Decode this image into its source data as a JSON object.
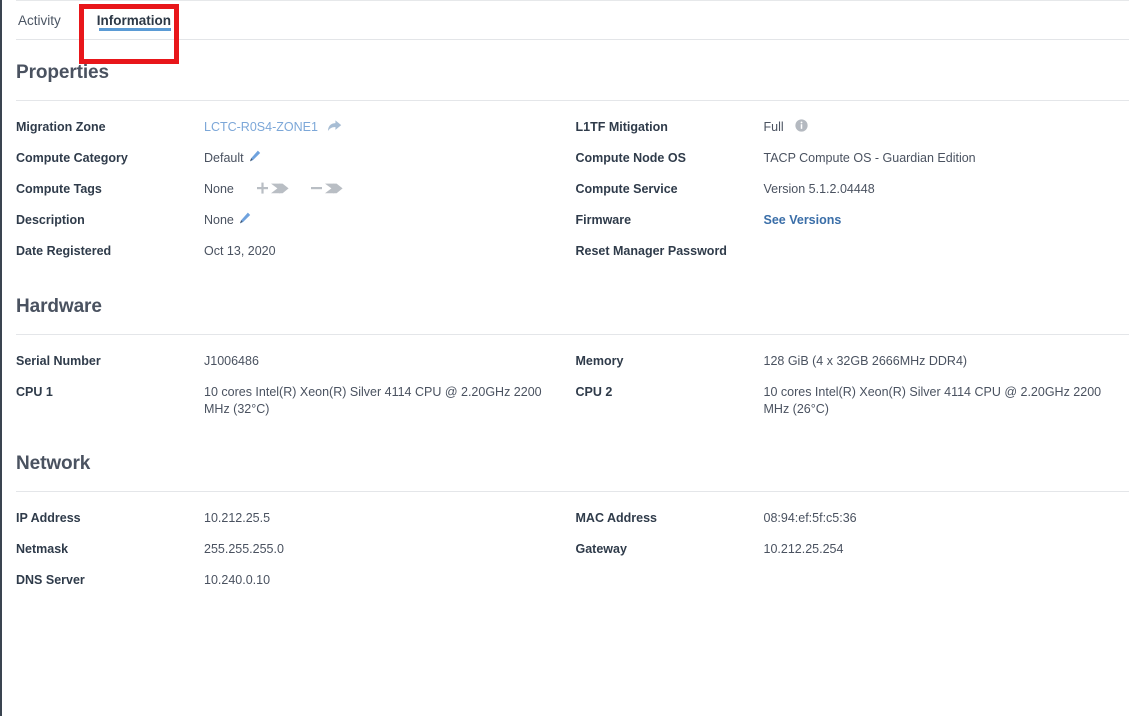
{
  "tabs": [
    {
      "label": "Activity",
      "active": false
    },
    {
      "label": "Information",
      "active": true
    }
  ],
  "annotation": {
    "target": "Information",
    "color": "#e8161a"
  },
  "colors": {
    "accent_tab_underline": "#5b9bd5",
    "link": "#7ca7d8",
    "link_strong": "#3a6ea8",
    "heading": "#4a5260",
    "label": "#2f3b4a",
    "value": "#4a5260",
    "annotation": "#e8161a"
  },
  "sections": [
    {
      "title": "Properties",
      "left": [
        {
          "label": "Migration Zone",
          "value": "LCTC-R0S4-ZONE1",
          "style": "link",
          "icons": [
            "share-icon"
          ]
        },
        {
          "label": "Compute Category",
          "value": "Default",
          "style": "plain",
          "icons": [
            "pencil-icon"
          ]
        },
        {
          "label": "Compute Tags",
          "value": "None",
          "style": "plain",
          "icons": [
            "add-tag-icon",
            "remove-tag-icon"
          ]
        },
        {
          "label": "Description",
          "value": "None",
          "style": "plain",
          "icons": [
            "pencil-icon"
          ]
        },
        {
          "label": "Date Registered",
          "value": "Oct 13, 2020",
          "style": "plain",
          "icons": []
        }
      ],
      "right": [
        {
          "label": "L1TF Mitigation",
          "value": "Full",
          "style": "plain",
          "icons": [
            "info-icon"
          ]
        },
        {
          "label": "Compute Node OS",
          "value": "TACP Compute OS - Guardian Edition",
          "style": "plain",
          "icons": []
        },
        {
          "label": "Compute Service",
          "value": "Version 5.1.2.04448",
          "style": "plain",
          "icons": []
        },
        {
          "label": "Firmware",
          "value": "See Versions",
          "style": "link-strong",
          "icons": []
        },
        {
          "label": "Reset Manager Password",
          "value": "",
          "style": "action-label",
          "icons": []
        }
      ]
    },
    {
      "title": "Hardware",
      "left": [
        {
          "label": "Serial Number",
          "value": "J1006486",
          "style": "plain",
          "icons": []
        },
        {
          "label": "CPU 1",
          "value": "10 cores Intel(R) Xeon(R) Silver 4114 CPU @ 2.20GHz 2200 MHz (32°C)",
          "style": "plain",
          "icons": []
        }
      ],
      "right": [
        {
          "label": "Memory",
          "value": "128 GiB (4 x 32GB 2666MHz DDR4)",
          "style": "plain",
          "icons": []
        },
        {
          "label": "CPU 2",
          "value": "10 cores Intel(R) Xeon(R) Silver 4114 CPU @ 2.20GHz 2200 MHz (26°C)",
          "style": "plain",
          "icons": []
        }
      ]
    },
    {
      "title": "Network",
      "left": [
        {
          "label": "IP Address",
          "value": "10.212.25.5",
          "style": "plain",
          "icons": []
        },
        {
          "label": "Netmask",
          "value": "255.255.255.0",
          "style": "plain",
          "icons": []
        },
        {
          "label": "DNS Server",
          "value": "10.240.0.10",
          "style": "plain",
          "icons": []
        }
      ],
      "right": [
        {
          "label": "MAC Address",
          "value": "08:94:ef:5f:c5:36",
          "style": "plain",
          "icons": []
        },
        {
          "label": "Gateway",
          "value": "10.212.25.254",
          "style": "plain",
          "icons": []
        }
      ]
    }
  ]
}
